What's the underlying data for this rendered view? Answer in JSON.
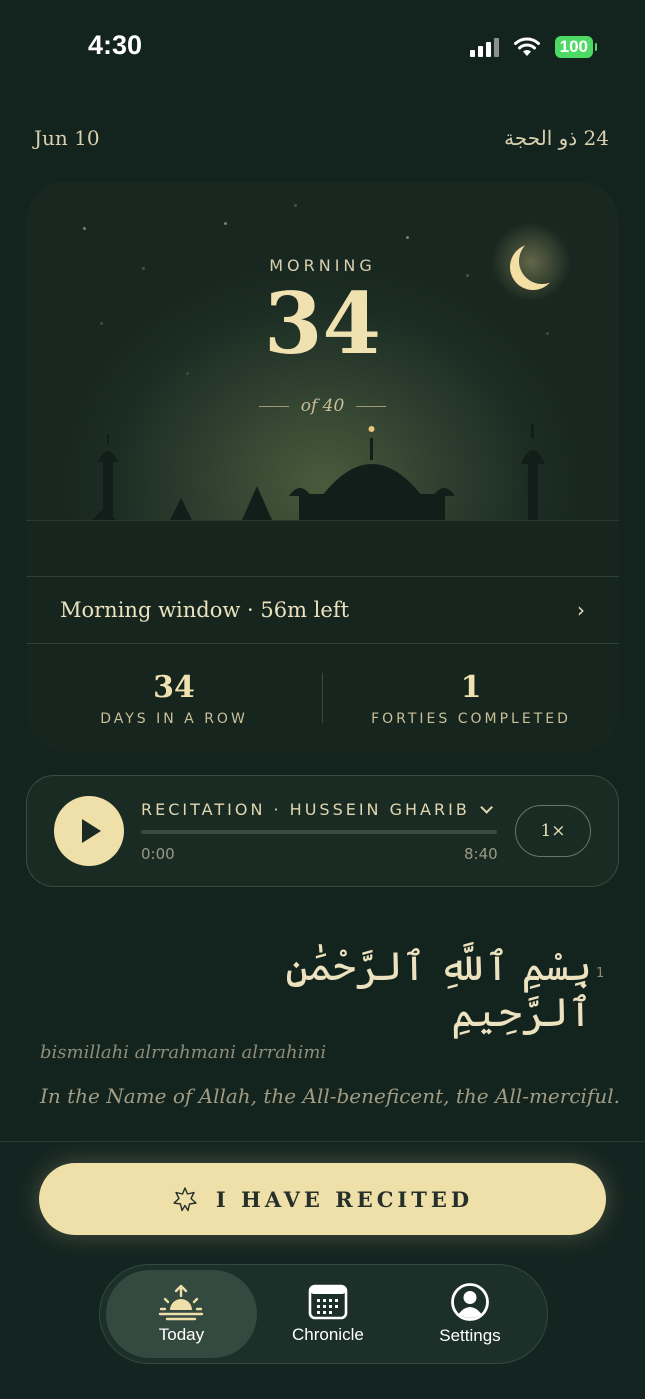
{
  "status_bar": {
    "time": "4:30",
    "battery": "100"
  },
  "header": {
    "date_gregorian": "Jun 10",
    "date_hijri": "24 ذو الحجة"
  },
  "hero": {
    "session_label": "MORNING",
    "count": "34",
    "of_total": "of 40",
    "window_text": "Morning window · 56m left",
    "chevron": "›"
  },
  "stats": [
    {
      "value": "34",
      "label": "DAYS IN A ROW"
    },
    {
      "value": "1",
      "label": "FORTIES COMPLETED"
    }
  ],
  "player": {
    "title": "RECITATION · HUSSEIN GHARIB",
    "time_current": "0:00",
    "time_total": "8:40",
    "progress_fraction": 0,
    "speed": "1×"
  },
  "verse": {
    "number": "1",
    "arabic": "بِسْمِ ٱللَّهِ ٱلرَّحْمَٰنِ ٱلرَّحِيمِ",
    "transliteration": "bismillahi alrrahmani alrrahimi",
    "translation": "In the Name of Allah, the All-beneficent, the All-merciful."
  },
  "action": {
    "label": "I HAVE RECITED"
  },
  "tabs": [
    {
      "label": "Today",
      "icon": "sunrise-icon",
      "active": true
    },
    {
      "label": "Chronicle",
      "icon": "calendar-icon",
      "active": false
    },
    {
      "label": "Settings",
      "icon": "account-icon",
      "active": false
    }
  ],
  "colors": {
    "background": "#13241e",
    "accent": "#efdfa8",
    "battery": "#4cd964"
  }
}
